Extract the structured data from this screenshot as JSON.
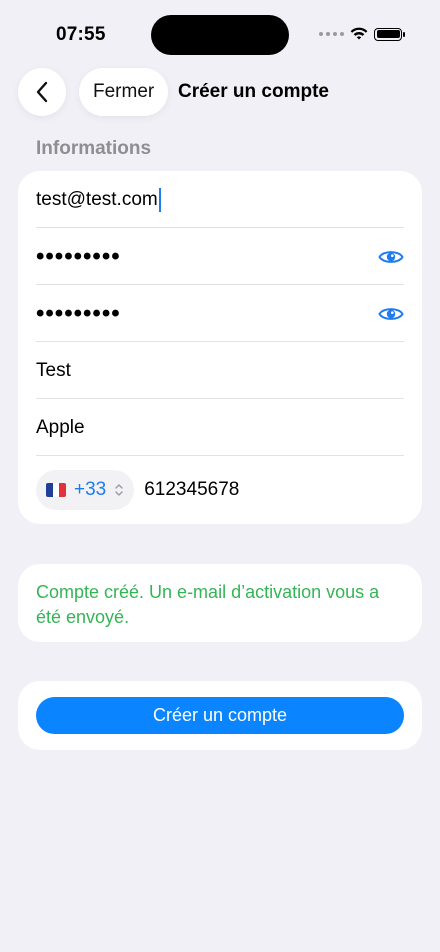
{
  "status_bar": {
    "time": "07:55"
  },
  "nav": {
    "back_icon": "chevron-left-icon",
    "close_label": "Fermer",
    "title": "Créer un compte"
  },
  "section": {
    "header": "Informations"
  },
  "form": {
    "email": "test@test.com",
    "password": "•••••••••",
    "password_confirm": "•••••••••",
    "first_name": "Test",
    "last_name": "Apple",
    "phone": {
      "country_flag": "flag-france-icon",
      "dial_code": "+33",
      "number": "612345678"
    }
  },
  "message": {
    "text": "Compte créé. Un e-mail d’activation vous a été envoyé."
  },
  "actions": {
    "create_label": "Créer un compte"
  },
  "colors": {
    "accent": "#0A84FF",
    "success": "#34B555",
    "background": "#F0F0F6"
  }
}
